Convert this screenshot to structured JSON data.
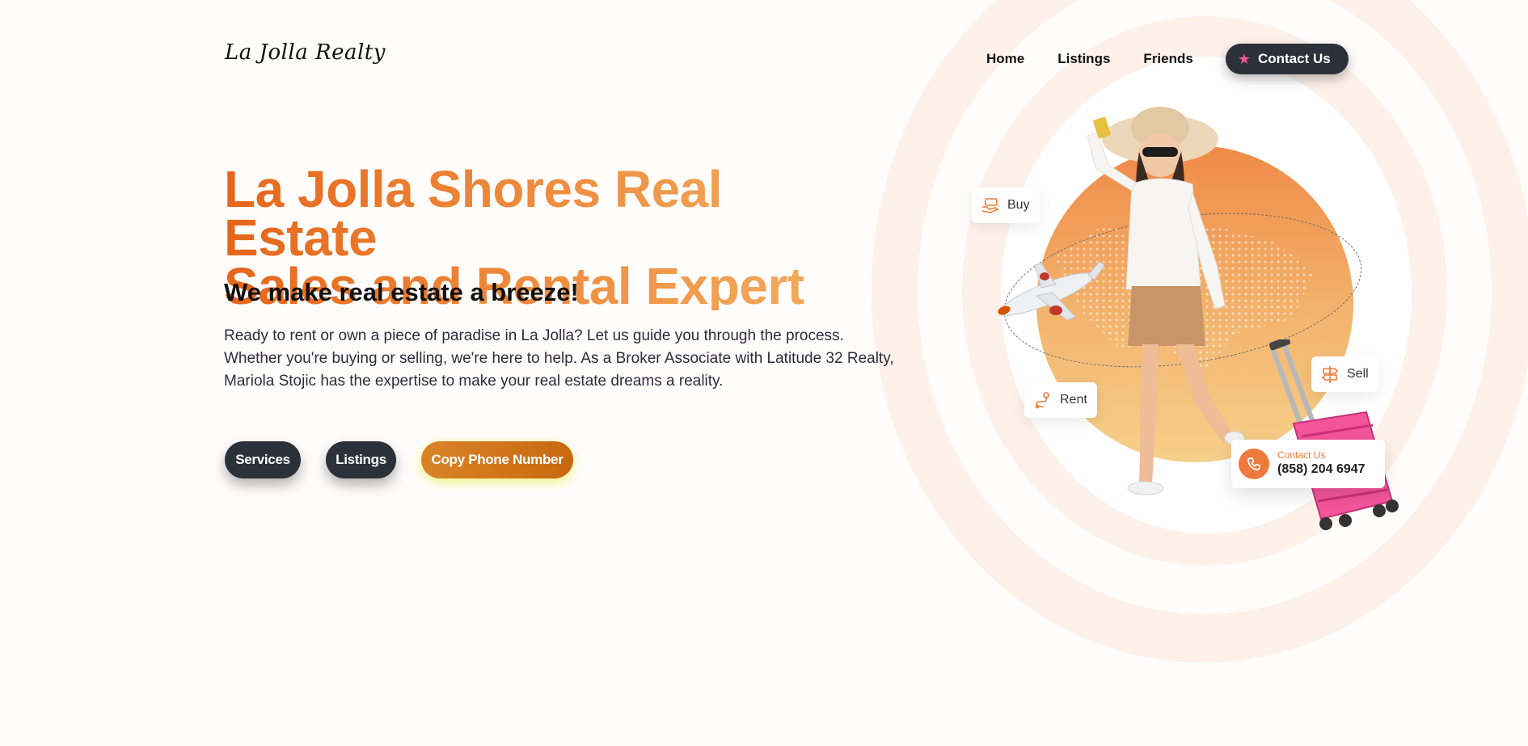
{
  "brand": {
    "logo_text": "La Jolla Realty"
  },
  "nav": {
    "items": [
      {
        "label": "Home"
      },
      {
        "label": "Listings"
      },
      {
        "label": "Friends"
      }
    ],
    "contact_label": "Contact Us",
    "contact_icon": "star-icon"
  },
  "hero": {
    "headline_line1": "La Jolla Shores Real Estate",
    "headline_line2": "Sales and Rental Expert",
    "subheadline": "We make real estate a breeze!",
    "description": "Ready to rent or own a piece of paradise in La Jolla? Let us guide you through the process. Whether you're buying or selling, we're here to help. As a Broker Associate with Latitude 32 Realty, Mariola Stojic has the expertise to make your real estate dreams a reality.",
    "buttons": {
      "services": "Services",
      "listings": "Listings",
      "copy_phone": "Copy Phone Number"
    }
  },
  "illustration": {
    "chips": {
      "buy": {
        "label": "Buy",
        "icon": "money-hand-icon"
      },
      "rent": {
        "label": "Rent",
        "icon": "route-icon"
      },
      "sell": {
        "label": "Sell",
        "icon": "signpost-icon"
      }
    },
    "phone_card": {
      "label": "Contact Us",
      "number": "(858) 204 6947",
      "icon": "phone-icon"
    }
  },
  "colors": {
    "accent_orange": "#ee7a3c",
    "dark_button": "#2c3039",
    "headline_gradient_start": "#e5661a",
    "headline_gradient_end": "#f3b263",
    "star_pink": "#f0589b"
  }
}
